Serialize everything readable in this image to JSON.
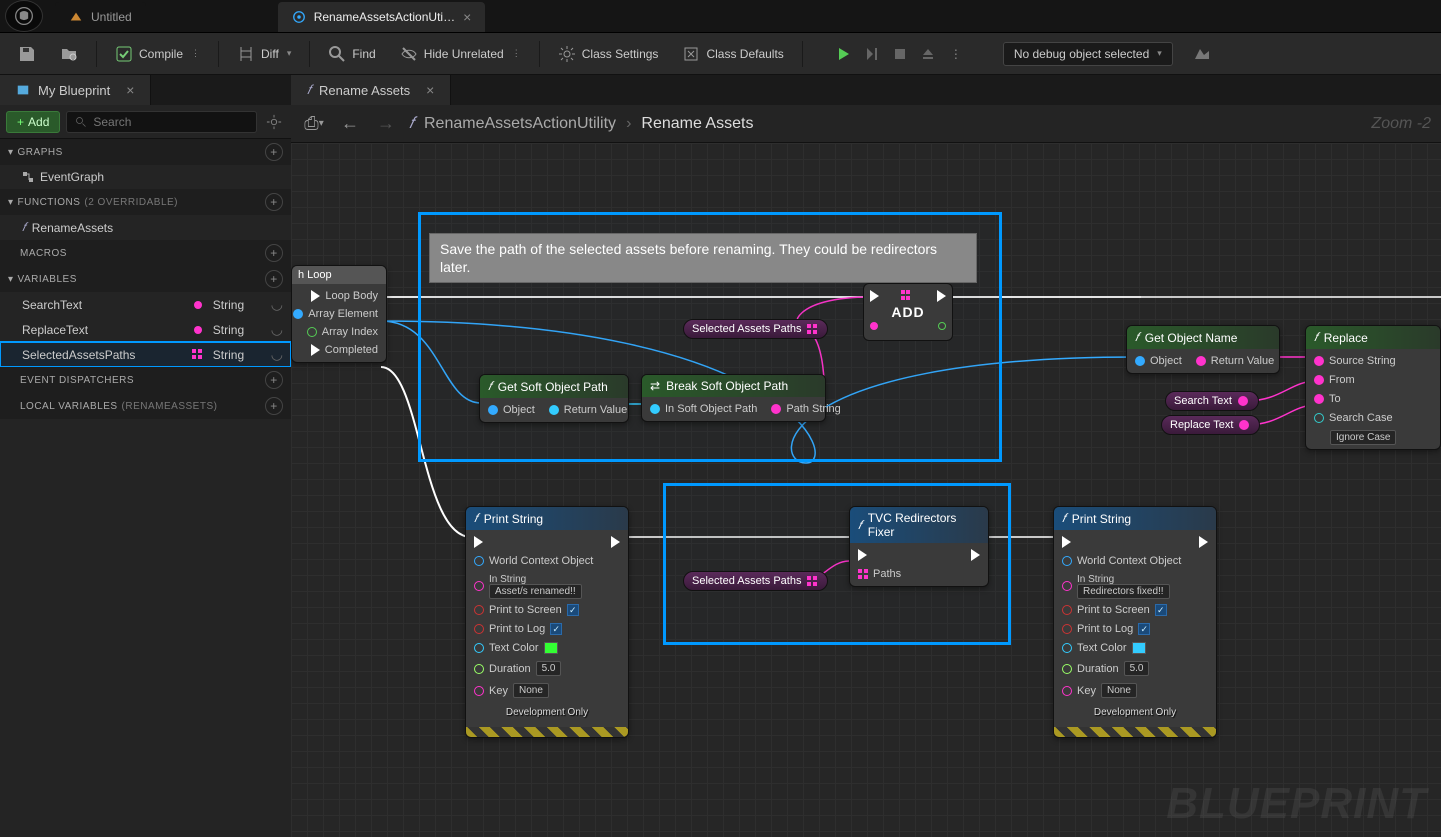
{
  "top_tabs": {
    "untitled": "Untitled",
    "active": "RenameAssetsActionUti…"
  },
  "toolbar": {
    "compile": "Compile",
    "diff": "Diff",
    "find": "Find",
    "hide_unrelated": "Hide Unrelated",
    "class_settings": "Class Settings",
    "class_defaults": "Class Defaults",
    "debug_select": "No debug object selected"
  },
  "sidebar": {
    "tab": "My Blueprint",
    "add": "Add",
    "search_placeholder": "Search",
    "sections": {
      "graphs": "GRAPHS",
      "functions": "FUNCTIONS",
      "functions_sub": "(2 OVERRIDABLE)",
      "macros": "MACROS",
      "variables": "VARIABLES",
      "event_dispatchers": "EVENT DISPATCHERS",
      "local_vars": "LOCAL VARIABLES",
      "local_vars_sub": "(RENAMEASSETS)"
    },
    "items": {
      "event_graph": "EventGraph",
      "rename_assets": "RenameAssets"
    },
    "vars": [
      {
        "name": "SearchText",
        "type": "String"
      },
      {
        "name": "ReplaceText",
        "type": "String"
      },
      {
        "name": "SelectedAssetsPaths",
        "type": "String"
      }
    ]
  },
  "canvas": {
    "tab": "Rename Assets",
    "breadcrumb_parent": "RenameAssetsActionUtility",
    "breadcrumb_current": "Rename Assets",
    "zoom": "Zoom -2"
  },
  "comment": {
    "text": "Save the path of the selected assets before renaming. They could be redirectors later."
  },
  "nodes": {
    "foreach": {
      "title": "h Loop",
      "loop_body": "Loop Body",
      "array_element": "Array Element",
      "array_index": "Array Index",
      "completed": "Completed"
    },
    "get_soft": {
      "title": "Get Soft Object Path",
      "in": "Object",
      "out": "Return Value"
    },
    "break_soft": {
      "title": "Break Soft Object Path",
      "in": "In Soft Object Path",
      "out": "Path String"
    },
    "sel_assets": "Selected Assets Paths",
    "add": "ADD",
    "get_obj_name": {
      "title": "Get Object Name",
      "in": "Object",
      "out": "Return Value"
    },
    "replace": {
      "title": "Replace",
      "source": "Source String",
      "from": "From",
      "to": "To",
      "search_case": "Search Case",
      "ignore": "Ignore Case"
    },
    "search_text": "Search Text",
    "replace_text": "Replace Text",
    "print1": {
      "title": "Print String",
      "world": "World Context Object",
      "in_string": "In String",
      "in_string_val": "Asset/s renamed!!",
      "print_screen": "Print to Screen",
      "print_log": "Print to Log",
      "text_color": "Text Color",
      "duration": "Duration",
      "duration_val": "5.0",
      "key": "Key",
      "key_val": "None",
      "dev": "Development Only"
    },
    "print2": {
      "title": "Print String",
      "in_string_val": "Redirectors fixed!!"
    },
    "tvc": {
      "title": "TVC Redirectors Fixer",
      "paths": "Paths"
    }
  }
}
